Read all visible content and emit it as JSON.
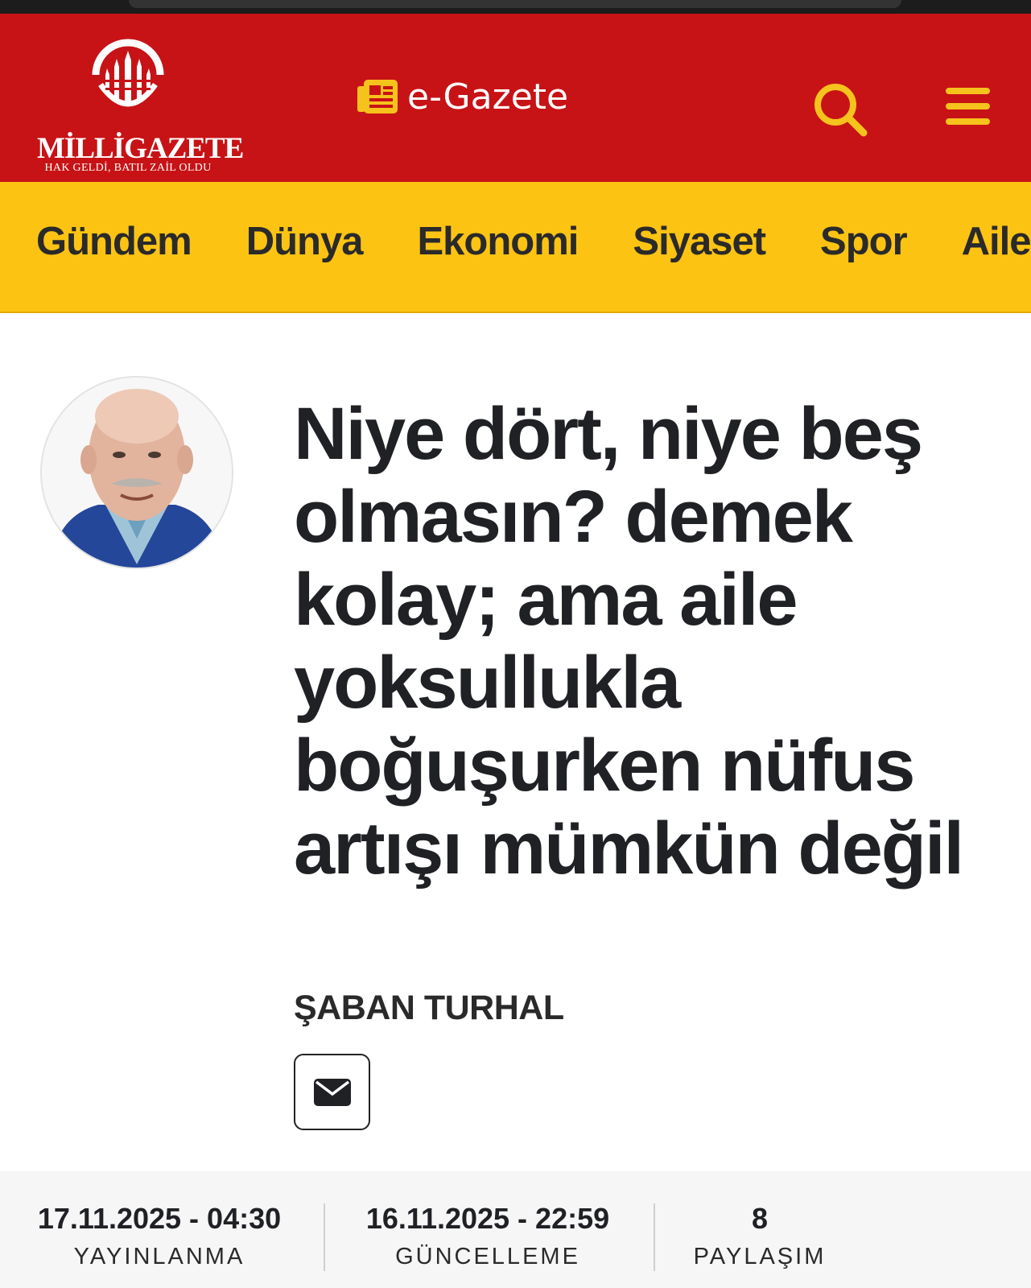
{
  "brand": {
    "name": "MİLLİGAZETE",
    "slogan": "HAK GELDİ, BATIL ZAİL OLDU",
    "primary_color": "#c71316",
    "accent_color": "#fdc313",
    "icon_color": "#f6c21c"
  },
  "header": {
    "egazete_label": "e-Gazete",
    "egazete_icon": "newspaper-icon",
    "search_icon": "search-icon",
    "menu_icon": "hamburger-menu-icon"
  },
  "nav": {
    "items": [
      "Gündem",
      "Dünya",
      "Ekonomi",
      "Siyaset",
      "Spor",
      "Aile & Sağlık"
    ]
  },
  "article": {
    "title": "Niye dört, niye beş olmasın? demek kolay; ama aile yoksullukla boğuşurken nüfus artışı mümkün değil",
    "author": "ŞABAN TURHAL",
    "mail_icon": "envelope-icon"
  },
  "meta": {
    "published_value": "17.11.2025 - 04:30",
    "published_label": "YAYINLANMA",
    "updated_value": "16.11.2025 - 22:59",
    "updated_label": "GÜNCELLEME",
    "shares_value": "8",
    "shares_label": "PAYLAŞIM"
  }
}
